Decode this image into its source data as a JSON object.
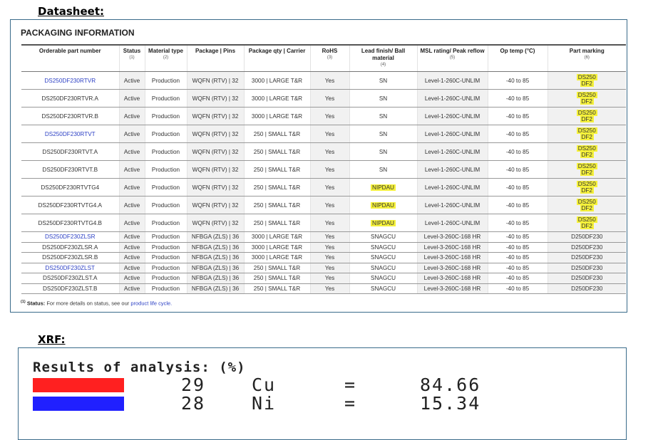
{
  "labels": {
    "datasheet": "Datasheet:",
    "xrf": "XRF:"
  },
  "datasheet": {
    "title": "PACKAGING INFORMATION",
    "columns": [
      {
        "label": "Orderable part number",
        "note": ""
      },
      {
        "label": "Status",
        "note": "(1)"
      },
      {
        "label": "Material type",
        "note": "(2)"
      },
      {
        "label": "Package | Pins",
        "note": ""
      },
      {
        "label": "Package qty | Carrier",
        "note": ""
      },
      {
        "label": "RoHS",
        "note": "(3)"
      },
      {
        "label": "Lead finish/ Ball material",
        "note": "(4)"
      },
      {
        "label": "MSL rating/ Peak reflow",
        "note": "(5)"
      },
      {
        "label": "Op temp (°C)",
        "note": ""
      },
      {
        "label": "Part marking",
        "note": "(6)"
      }
    ],
    "rows": [
      {
        "part": "DS250DF230RTVR",
        "link": true,
        "status": "Active",
        "material": "Production",
        "package": "WQFN (RTV) | 32",
        "qty": "3000 | LARGE T&R",
        "rohs": "Yes",
        "finish": "SN",
        "finish_hl": false,
        "msl": "Level-1-260C-UNLIM",
        "temp": "-40 to 85",
        "marking": [
          "DS250",
          "DF2"
        ],
        "mark_hl": true
      },
      {
        "part": "DS250DF230RTVR.A",
        "link": false,
        "status": "Active",
        "material": "Production",
        "package": "WQFN (RTV) | 32",
        "qty": "3000 | LARGE T&R",
        "rohs": "Yes",
        "finish": "SN",
        "finish_hl": false,
        "msl": "Level-1-260C-UNLIM",
        "temp": "-40 to 85",
        "marking": [
          "DS250",
          "DF2"
        ],
        "mark_hl": true
      },
      {
        "part": "DS250DF230RTVR.B",
        "link": false,
        "status": "Active",
        "material": "Production",
        "package": "WQFN (RTV) | 32",
        "qty": "3000 | LARGE T&R",
        "rohs": "Yes",
        "finish": "SN",
        "finish_hl": false,
        "msl": "Level-1-260C-UNLIM",
        "temp": "-40 to 85",
        "marking": [
          "DS250",
          "DF2"
        ],
        "mark_hl": true
      },
      {
        "part": "DS250DF230RTVT",
        "link": true,
        "status": "Active",
        "material": "Production",
        "package": "WQFN (RTV) | 32",
        "qty": "250 | SMALL T&R",
        "rohs": "Yes",
        "finish": "SN",
        "finish_hl": false,
        "msl": "Level-1-260C-UNLIM",
        "temp": "-40 to 85",
        "marking": [
          "DS250",
          "DF2"
        ],
        "mark_hl": true
      },
      {
        "part": "DS250DF230RTVT.A",
        "link": false,
        "status": "Active",
        "material": "Production",
        "package": "WQFN (RTV) | 32",
        "qty": "250 | SMALL T&R",
        "rohs": "Yes",
        "finish": "SN",
        "finish_hl": false,
        "msl": "Level-1-260C-UNLIM",
        "temp": "-40 to 85",
        "marking": [
          "DS250",
          "DF2"
        ],
        "mark_hl": true
      },
      {
        "part": "DS250DF230RTVT.B",
        "link": false,
        "status": "Active",
        "material": "Production",
        "package": "WQFN (RTV) | 32",
        "qty": "250 | SMALL T&R",
        "rohs": "Yes",
        "finish": "SN",
        "finish_hl": false,
        "msl": "Level-1-260C-UNLIM",
        "temp": "-40 to 85",
        "marking": [
          "DS250",
          "DF2"
        ],
        "mark_hl": true
      },
      {
        "part": "DS250DF230RTVTG4",
        "link": false,
        "status": "Active",
        "material": "Production",
        "package": "WQFN (RTV) | 32",
        "qty": "250 | SMALL T&R",
        "rohs": "Yes",
        "finish": "NIPDAU",
        "finish_hl": true,
        "msl": "Level-1-260C-UNLIM",
        "temp": "-40 to 85",
        "marking": [
          "DS250",
          "DF2"
        ],
        "mark_hl": true
      },
      {
        "part": "DS250DF230RTVTG4.A",
        "link": false,
        "status": "Active",
        "material": "Production",
        "package": "WQFN (RTV) | 32",
        "qty": "250 | SMALL T&R",
        "rohs": "Yes",
        "finish": "NIPDAU",
        "finish_hl": true,
        "msl": "Level-1-260C-UNLIM",
        "temp": "-40 to 85",
        "marking": [
          "DS250",
          "DF2"
        ],
        "mark_hl": true
      },
      {
        "part": "DS250DF230RTVTG4.B",
        "link": false,
        "status": "Active",
        "material": "Production",
        "package": "WQFN (RTV) | 32",
        "qty": "250 | SMALL T&R",
        "rohs": "Yes",
        "finish": "NIPDAU",
        "finish_hl": true,
        "msl": "Level-1-260C-UNLIM",
        "temp": "-40 to 85",
        "marking": [
          "DS250",
          "DF2"
        ],
        "mark_hl": true
      },
      {
        "part": "DS250DF230ZLSR",
        "link": true,
        "status": "Active",
        "material": "Production",
        "package": "NFBGA (ZLS) | 36",
        "qty": "3000 | LARGE T&R",
        "rohs": "Yes",
        "finish": "SNAGCU",
        "finish_hl": false,
        "msl": "Level-3-260C-168 HR",
        "temp": "-40 to 85",
        "marking": [
          "D250DF230"
        ],
        "mark_hl": false
      },
      {
        "part": "DS250DF230ZLSR.A",
        "link": false,
        "status": "Active",
        "material": "Production",
        "package": "NFBGA (ZLS) | 36",
        "qty": "3000 | LARGE T&R",
        "rohs": "Yes",
        "finish": "SNAGCU",
        "finish_hl": false,
        "msl": "Level-3-260C-168 HR",
        "temp": "-40 to 85",
        "marking": [
          "D250DF230"
        ],
        "mark_hl": false
      },
      {
        "part": "DS250DF230ZLSR.B",
        "link": false,
        "status": "Active",
        "material": "Production",
        "package": "NFBGA (ZLS) | 36",
        "qty": "3000 | LARGE T&R",
        "rohs": "Yes",
        "finish": "SNAGCU",
        "finish_hl": false,
        "msl": "Level-3-260C-168 HR",
        "temp": "-40 to 85",
        "marking": [
          "D250DF230"
        ],
        "mark_hl": false
      },
      {
        "part": "DS250DF230ZLST",
        "link": true,
        "status": "Active",
        "material": "Production",
        "package": "NFBGA (ZLS) | 36",
        "qty": "250 | SMALL T&R",
        "rohs": "Yes",
        "finish": "SNAGCU",
        "finish_hl": false,
        "msl": "Level-3-260C-168 HR",
        "temp": "-40 to 85",
        "marking": [
          "D250DF230"
        ],
        "mark_hl": false
      },
      {
        "part": "DS250DF230ZLST.A",
        "link": false,
        "status": "Active",
        "material": "Production",
        "package": "NFBGA (ZLS) | 36",
        "qty": "250 | SMALL T&R",
        "rohs": "Yes",
        "finish": "SNAGCU",
        "finish_hl": false,
        "msl": "Level-3-260C-168 HR",
        "temp": "-40 to 85",
        "marking": [
          "D250DF230"
        ],
        "mark_hl": false
      },
      {
        "part": "DS250DF230ZLST.B",
        "link": false,
        "status": "Active",
        "material": "Production",
        "package": "NFBGA (ZLS) | 36",
        "qty": "250 | SMALL T&R",
        "rohs": "Yes",
        "finish": "SNAGCU",
        "finish_hl": false,
        "msl": "Level-3-260C-168 HR",
        "temp": "-40 to 85",
        "marking": [
          "D250DF230"
        ],
        "mark_hl": false
      }
    ],
    "footnote": {
      "marker": "(1)",
      "label": "Status:",
      "text": "For more details on status, see our",
      "link": "product life cycle."
    }
  },
  "xrf": {
    "heading": "Results of analysis: (%)",
    "results": [
      {
        "swatch": "#ff2020",
        "atomic": "29",
        "element": "Cu",
        "eq": "=",
        "value": "84.66"
      },
      {
        "swatch": "#2020ff",
        "atomic": "28",
        "element": "Ni",
        "eq": "=",
        "value": "15.34"
      }
    ]
  }
}
